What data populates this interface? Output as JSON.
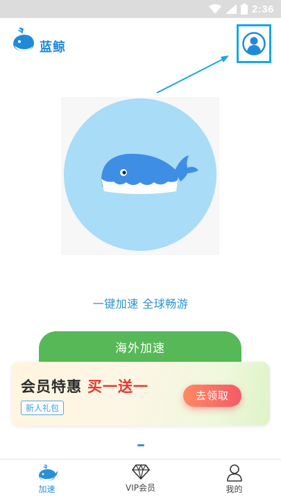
{
  "status_bar": {
    "time": "2:36",
    "icons": [
      "wifi-icon",
      "signal-icon",
      "battery-icon"
    ]
  },
  "app": {
    "name": "蓝鲸",
    "accent_color": "#1f8ad8"
  },
  "hero": {
    "image": "whale-illustration"
  },
  "slogan": "一键加速 全球畅游",
  "accelerate_button": {
    "label": "海外加速",
    "color": "#57b857"
  },
  "promo": {
    "title": "会员特惠",
    "highlight": "买一送一",
    "tag": "新人礼包",
    "button": "去领取"
  },
  "bottom_nav": {
    "items": [
      {
        "label": "加速",
        "icon": "whale-icon",
        "active": true
      },
      {
        "label": "VIP会员",
        "icon": "diamond-icon",
        "active": false
      },
      {
        "label": "我的",
        "icon": "user-icon",
        "active": false
      }
    ]
  }
}
